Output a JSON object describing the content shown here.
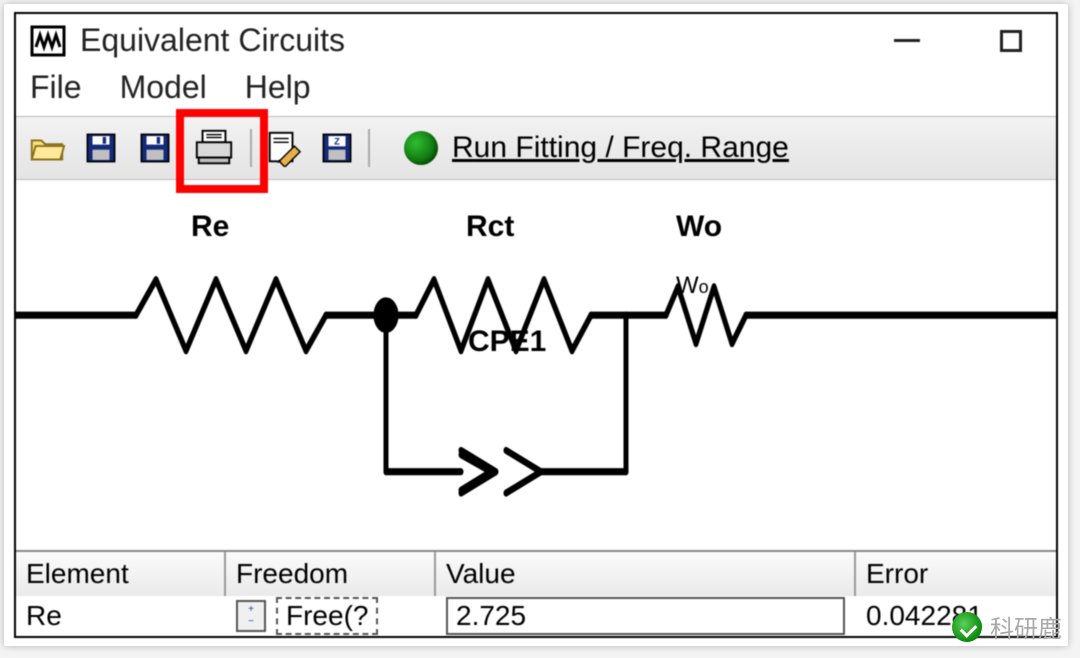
{
  "window": {
    "title": "Equivalent Circuits"
  },
  "menu": {
    "file": "File",
    "model": "Model",
    "help": "Help"
  },
  "toolbar": {
    "run_label": "Run Fitting / Freq. Range"
  },
  "circuit": {
    "labels": {
      "re": "Re",
      "rct": "Rct",
      "wo": "Wo",
      "cpe1": "CPE1"
    }
  },
  "table": {
    "headers": {
      "element": "Element",
      "freedom": "Freedom",
      "value": "Value",
      "error": "Error"
    },
    "rows": [
      {
        "element": "Re",
        "freedom": "Free(?",
        "value": "2.725",
        "error": "0.042281"
      }
    ]
  },
  "watermark": {
    "text": "科研鹿"
  }
}
